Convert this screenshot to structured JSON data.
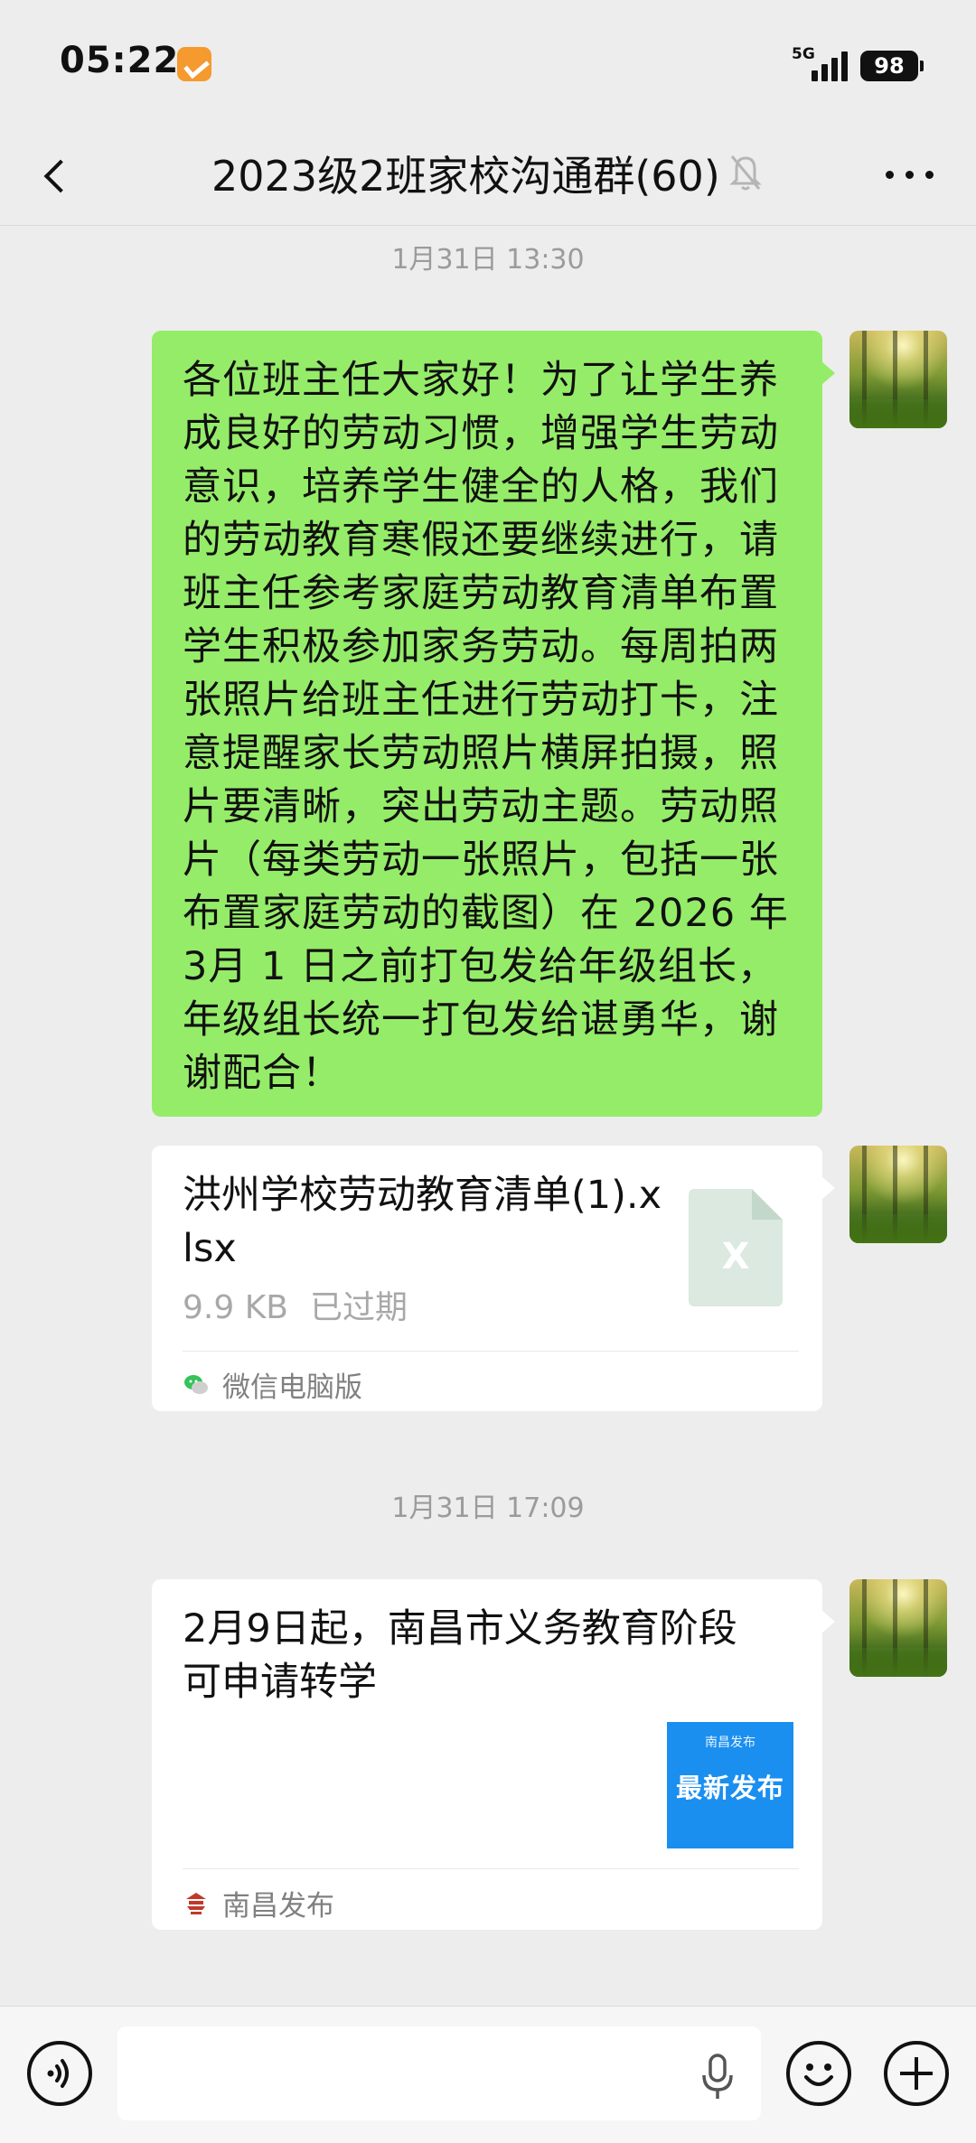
{
  "status_bar": {
    "time": "05:22",
    "network": "5G",
    "battery": "98",
    "notification_icon": "app-notification-icon"
  },
  "header": {
    "title": "2023级2班家校沟通群(60)",
    "back_icon": "chevron-left-icon",
    "mute_icon": "bell-muted-icon",
    "more_icon": "more-dots-icon"
  },
  "messages": [
    {
      "type": "timestamp",
      "text": "1月31日 13:30"
    },
    {
      "type": "text",
      "text": "各位班主任大家好！为了让学生养成良好的劳动习惯，增强学生劳动意识，培养学生健全的人格，我们的劳动教育寒假还要继续进行，请班主任参考家庭劳动教育清单布置学生积极参加家务劳动。每周拍两张照片给班主任进行劳动打卡，注意提醒家长劳动照片横屏拍摄，照片要清晰，突出劳动主题。劳动照片（每类劳动一张照片，包括一张布置家庭劳动的截图）在 2026 年 3月 1 日之前打包发给年级组长，年级组长统一打包发给谌勇华，谢谢配合！"
    },
    {
      "type": "file",
      "file_name": "洪州学校劳动教育清单(1).xlsx",
      "size": "9.9 KB",
      "status": "已过期",
      "file_icon_letter": "X",
      "source": "微信电脑版"
    },
    {
      "type": "timestamp",
      "text": "1月31日 17:09"
    },
    {
      "type": "article",
      "title": "2月9日起，南昌市义务教育阶段可申请转学",
      "thumb_top": "南昌发布",
      "thumb_main": "最新发布",
      "source": "南昌发布"
    }
  ],
  "input_bar": {
    "placeholder": "",
    "voice_icon": "voice-icon",
    "mic_icon": "microphone-icon",
    "emoji_icon": "emoji-icon",
    "plus_icon": "plus-icon"
  },
  "colors": {
    "background": "#ededed",
    "self_bubble": "#95ec69",
    "card": "#ffffff",
    "timestamp": "#9b9b9b",
    "thumb": "#1a8ff0"
  }
}
